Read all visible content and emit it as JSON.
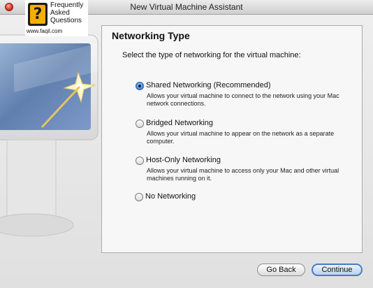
{
  "window": {
    "title": "New Virtual Machine Assistant"
  },
  "logo": {
    "line1": "Frequently",
    "line2": "Asked",
    "line3": "Questions",
    "url": "www.faqil.com",
    "mark": "?"
  },
  "panel": {
    "heading": "Networking Type",
    "prompt": "Select the type of networking for the virtual machine:"
  },
  "options": [
    {
      "label": "Shared Networking (Recommended)",
      "desc": "Allows your virtual machine to connect to the network using your Mac network connections.",
      "selected": true
    },
    {
      "label": "Bridged Networking",
      "desc": "Allows your virtual machine to appear on the network as a separate computer.",
      "selected": false
    },
    {
      "label": "Host-Only Networking",
      "desc": "Allows your virtual machine to access only your Mac and other virtual machines running on it.",
      "selected": false
    },
    {
      "label": "No Networking",
      "desc": "",
      "selected": false
    }
  ],
  "buttons": {
    "back": "Go Back",
    "continue": "Continue"
  }
}
